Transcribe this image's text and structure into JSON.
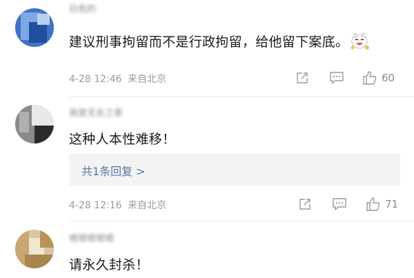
{
  "comments": [
    {
      "username": "白色的",
      "text": "建议刑事拘留而不是行政拘留，给他留下案底。",
      "emoji_icon": "laughing-cat-emoji",
      "timestamp": "4-28 12:46",
      "location": "来自北京",
      "likes": "60"
    },
    {
      "username": "我是无名之辈",
      "text": "这种人本性难移！",
      "replies_label": "共1条回复 >",
      "timestamp": "4-28 12:16",
      "location": "来自北京",
      "likes": "71"
    },
    {
      "username": "嗯嗯嗯嗯嗯",
      "text": "请永久封杀！"
    }
  ],
  "icons": {
    "share": "share-icon",
    "comment": "comment-icon",
    "like": "thumbs-up-icon"
  }
}
